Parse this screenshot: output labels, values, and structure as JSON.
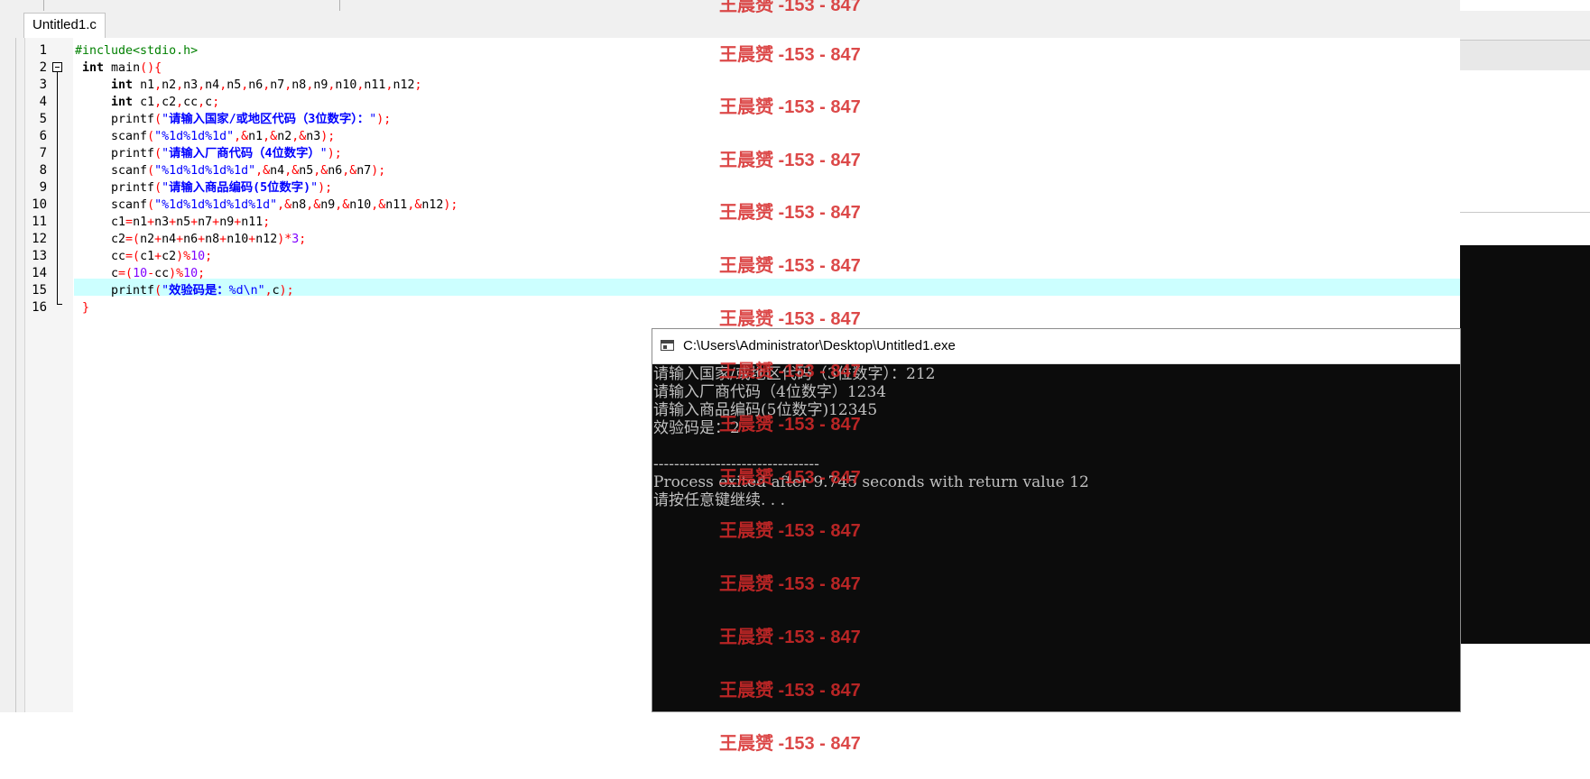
{
  "editor": {
    "tab_label": "Untitled1.c",
    "line_numbers": [
      "1",
      "2",
      "3",
      "4",
      "5",
      "6",
      "7",
      "8",
      "9",
      "10",
      "11",
      "12",
      "13",
      "14",
      "15",
      "16"
    ],
    "lines": [
      [
        {
          "t": "#include<stdio.h>",
          "c": "pp"
        }
      ],
      [
        {
          "t": " "
        },
        {
          "t": "int",
          "c": "kw"
        },
        {
          "t": " main"
        },
        {
          "t": "(){",
          "c": "sym"
        }
      ],
      [
        {
          "t": "     "
        },
        {
          "t": "int",
          "c": "kw"
        },
        {
          "t": " n1"
        },
        {
          "t": ",",
          "c": "sym"
        },
        {
          "t": "n2"
        },
        {
          "t": ",",
          "c": "sym"
        },
        {
          "t": "n3"
        },
        {
          "t": ",",
          "c": "sym"
        },
        {
          "t": "n4"
        },
        {
          "t": ",",
          "c": "sym"
        },
        {
          "t": "n5"
        },
        {
          "t": ",",
          "c": "sym"
        },
        {
          "t": "n6"
        },
        {
          "t": ",",
          "c": "sym"
        },
        {
          "t": "n7"
        },
        {
          "t": ",",
          "c": "sym"
        },
        {
          "t": "n8"
        },
        {
          "t": ",",
          "c": "sym"
        },
        {
          "t": "n9"
        },
        {
          "t": ",",
          "c": "sym"
        },
        {
          "t": "n10"
        },
        {
          "t": ",",
          "c": "sym"
        },
        {
          "t": "n11"
        },
        {
          "t": ",",
          "c": "sym"
        },
        {
          "t": "n12"
        },
        {
          "t": ";",
          "c": "sym"
        }
      ],
      [
        {
          "t": "     "
        },
        {
          "t": "int",
          "c": "kw"
        },
        {
          "t": " c1"
        },
        {
          "t": ",",
          "c": "sym"
        },
        {
          "t": "c2"
        },
        {
          "t": ",",
          "c": "sym"
        },
        {
          "t": "cc"
        },
        {
          "t": ",",
          "c": "sym"
        },
        {
          "t": "c"
        },
        {
          "t": ";",
          "c": "sym"
        }
      ],
      [
        {
          "t": "     printf"
        },
        {
          "t": "(",
          "c": "sym"
        },
        {
          "t": "\"",
          "c": "str"
        },
        {
          "t": "请输入国家/或地区代码（3位数字）：",
          "c": "strb"
        },
        {
          "t": "\"",
          "c": "str"
        },
        {
          "t": ");",
          "c": "sym"
        }
      ],
      [
        {
          "t": "     scanf"
        },
        {
          "t": "(",
          "c": "sym"
        },
        {
          "t": "\"%1d%1d%1d\"",
          "c": "str"
        },
        {
          "t": ",&",
          "c": "sym"
        },
        {
          "t": "n1"
        },
        {
          "t": ",&",
          "c": "sym"
        },
        {
          "t": "n2"
        },
        {
          "t": ",&",
          "c": "sym"
        },
        {
          "t": "n3"
        },
        {
          "t": ");",
          "c": "sym"
        }
      ],
      [
        {
          "t": "     printf"
        },
        {
          "t": "(",
          "c": "sym"
        },
        {
          "t": "\"",
          "c": "str"
        },
        {
          "t": "请输入厂商代码（4位数字）",
          "c": "strb"
        },
        {
          "t": "\"",
          "c": "str"
        },
        {
          "t": ");",
          "c": "sym"
        }
      ],
      [
        {
          "t": "     scanf"
        },
        {
          "t": "(",
          "c": "sym"
        },
        {
          "t": "\"%1d%1d%1d%1d\"",
          "c": "str"
        },
        {
          "t": ",&",
          "c": "sym"
        },
        {
          "t": "n4"
        },
        {
          "t": ",&",
          "c": "sym"
        },
        {
          "t": "n5"
        },
        {
          "t": ",&",
          "c": "sym"
        },
        {
          "t": "n6"
        },
        {
          "t": ",&",
          "c": "sym"
        },
        {
          "t": "n7"
        },
        {
          "t": ");",
          "c": "sym"
        }
      ],
      [
        {
          "t": "     printf"
        },
        {
          "t": "(",
          "c": "sym"
        },
        {
          "t": "\"",
          "c": "str"
        },
        {
          "t": "请输入商品编码(5位数字)",
          "c": "strb"
        },
        {
          "t": "\"",
          "c": "str"
        },
        {
          "t": ");",
          "c": "sym"
        }
      ],
      [
        {
          "t": "     scanf"
        },
        {
          "t": "(",
          "c": "sym"
        },
        {
          "t": "\"%1d%1d%1d%1d%1d\"",
          "c": "str"
        },
        {
          "t": ",&",
          "c": "sym"
        },
        {
          "t": "n8"
        },
        {
          "t": ",&",
          "c": "sym"
        },
        {
          "t": "n9"
        },
        {
          "t": ",&",
          "c": "sym"
        },
        {
          "t": "n10"
        },
        {
          "t": ",&",
          "c": "sym"
        },
        {
          "t": "n11"
        },
        {
          "t": ",&",
          "c": "sym"
        },
        {
          "t": "n12"
        },
        {
          "t": ");",
          "c": "sym"
        }
      ],
      [
        {
          "t": "     c1"
        },
        {
          "t": "=",
          "c": "sym"
        },
        {
          "t": "n1"
        },
        {
          "t": "+",
          "c": "sym"
        },
        {
          "t": "n3"
        },
        {
          "t": "+",
          "c": "sym"
        },
        {
          "t": "n5"
        },
        {
          "t": "+",
          "c": "sym"
        },
        {
          "t": "n7"
        },
        {
          "t": "+",
          "c": "sym"
        },
        {
          "t": "n9"
        },
        {
          "t": "+",
          "c": "sym"
        },
        {
          "t": "n11"
        },
        {
          "t": ";",
          "c": "sym"
        }
      ],
      [
        {
          "t": "     c2"
        },
        {
          "t": "=(",
          "c": "sym"
        },
        {
          "t": "n2"
        },
        {
          "t": "+",
          "c": "sym"
        },
        {
          "t": "n4"
        },
        {
          "t": "+",
          "c": "sym"
        },
        {
          "t": "n6"
        },
        {
          "t": "+",
          "c": "sym"
        },
        {
          "t": "n8"
        },
        {
          "t": "+",
          "c": "sym"
        },
        {
          "t": "n10"
        },
        {
          "t": "+",
          "c": "sym"
        },
        {
          "t": "n12"
        },
        {
          "t": ")*",
          "c": "sym"
        },
        {
          "t": "3",
          "c": "num"
        },
        {
          "t": ";",
          "c": "sym"
        }
      ],
      [
        {
          "t": "     cc"
        },
        {
          "t": "=(",
          "c": "sym"
        },
        {
          "t": "c1"
        },
        {
          "t": "+",
          "c": "sym"
        },
        {
          "t": "c2"
        },
        {
          "t": ")%",
          "c": "sym"
        },
        {
          "t": "10",
          "c": "num"
        },
        {
          "t": ";",
          "c": "sym"
        }
      ],
      [
        {
          "t": "     c"
        },
        {
          "t": "=(",
          "c": "sym"
        },
        {
          "t": "10",
          "c": "num"
        },
        {
          "t": "-",
          "c": "sym"
        },
        {
          "t": "cc"
        },
        {
          "t": ")%",
          "c": "sym"
        },
        {
          "t": "10",
          "c": "num"
        },
        {
          "t": ";",
          "c": "sym"
        }
      ],
      [
        {
          "t": "     printf"
        },
        {
          "t": "(",
          "c": "sym"
        },
        {
          "t": "\"",
          "c": "str"
        },
        {
          "t": "效验码是：",
          "c": "strb"
        },
        {
          "t": "%d\\n\"",
          "c": "str"
        },
        {
          "t": ",",
          "c": "sym"
        },
        {
          "t": "c"
        },
        {
          "t": ");",
          "c": "sym"
        }
      ],
      [
        {
          "t": " "
        },
        {
          "t": "}",
          "c": "sym"
        }
      ]
    ]
  },
  "console": {
    "title": "C:\\Users\\Administrator\\Desktop\\Untitled1.exe",
    "lines": [
      "请输入国家/或地区代码（3位数字）：212",
      "请输入厂商代码（4位数字）1234",
      "请输入商品编码(5位数字)12345",
      "效验码是：2",
      "",
      "--------------------------------",
      "Process exited after 9.745 seconds with return value 12",
      "请按任意键继续. . ."
    ]
  },
  "watermark": {
    "text": "王晨赟 -153 - 847",
    "color": "#d62a2a"
  }
}
